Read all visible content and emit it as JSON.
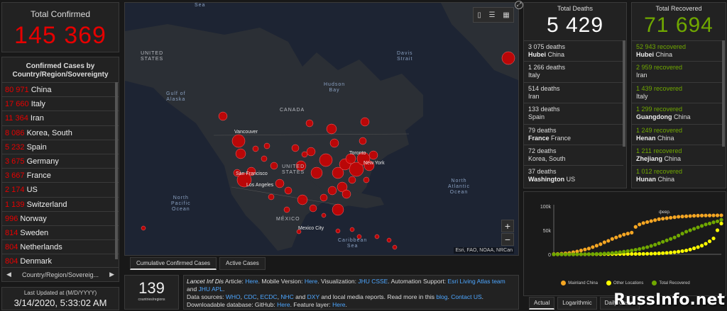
{
  "total_confirmed": {
    "label": "Total Confirmed",
    "value": "145 369"
  },
  "country_list": {
    "header": "Confirmed Cases by Country/Region/Sovereignty",
    "items": [
      {
        "n": "80 971",
        "c": "China"
      },
      {
        "n": "17 660",
        "c": "Italy"
      },
      {
        "n": "11 364",
        "c": "Iran"
      },
      {
        "n": "8 086",
        "c": "Korea, South"
      },
      {
        "n": "5 232",
        "c": "Spain"
      },
      {
        "n": "3 675",
        "c": "Germany"
      },
      {
        "n": "3 667",
        "c": "France"
      },
      {
        "n": "2 174",
        "c": "US"
      },
      {
        "n": "1 139",
        "c": "Switzerland"
      },
      {
        "n": "996",
        "c": "Norway"
      },
      {
        "n": "814",
        "c": "Sweden"
      },
      {
        "n": "804",
        "c": "Netherlands"
      },
      {
        "n": "804",
        "c": "Denmark"
      }
    ],
    "selector": "Country/Region/Sovereig..."
  },
  "last_updated": {
    "label": "Last Updated at (M/D/YYYY)",
    "value": "3/14/2020, 5:33:02 AM"
  },
  "map": {
    "labels": {
      "sea": "Sea",
      "united_states_top": "UNITED\nSTATES",
      "gulf_alaska": "Gulf of\nAlaska",
      "hudson": "Hudson\nBay",
      "davis": "Davis\nStrait",
      "canada": "CANADA",
      "united_states": "UNITED\nSTATES",
      "north_pacific": "North\nPacific\nOcean",
      "north_atlantic": "North\nAtlantic\nOcean",
      "mexico": "MÉXICO",
      "caribbean": "Caribbean\nSea",
      "vancouver": "Vancouver",
      "toronto": "Toronto",
      "new_york": "New York",
      "san_francisco": "San Francisco",
      "los_angeles": "Los Angeles",
      "mexico_city": "Mexico City"
    },
    "attribution": "Esri, FAO, NOAA, NRCan",
    "zoom_in": "+",
    "zoom_out": "−"
  },
  "map_tabs": [
    "Cumulative Confirmed Cases",
    "Active Cases"
  ],
  "country_count": {
    "value": "139",
    "label": "countries/regions"
  },
  "info": {
    "p1": "Lancet Inf Dis",
    "p1b": " Article: ",
    "here1": "Here",
    "p2": ". Mobile Version: ",
    "here2": "Here",
    "p3": ". Visualization: ",
    "jhu": "JHU CSSE",
    "p4": ". Automation Support: ",
    "esri": "Esri Living Atlas team",
    "p5": " and ",
    "jhuapl": "JHU APL",
    "p6": ".",
    "p7": "Data sources: ",
    "who": "WHO",
    "cdc": "CDC",
    "ecdc": "ECDC",
    "nhc": "NHC",
    "p8": " and ",
    "dxy": "DXY",
    "p9": " and local media reports. Read more in this ",
    "blog": "blog",
    "p10": ". ",
    "contact": "Contact US",
    "p11": ".",
    "p12": "Downloadable database: GitHub: ",
    "here3": "Here",
    "p13": ". Feature layer: ",
    "here4": "Here",
    "p14": "."
  },
  "deaths": {
    "label": "Total Deaths",
    "value": "5 429",
    "items": [
      {
        "v": "3 075 deaths",
        "p": "Hubei",
        "r": " China"
      },
      {
        "v": "1 266 deaths",
        "p": "",
        "r": "Italy"
      },
      {
        "v": "514 deaths",
        "p": "",
        "r": "Iran"
      },
      {
        "v": "133 deaths",
        "p": "",
        "r": "Spain"
      },
      {
        "v": "79 deaths",
        "p": "France",
        "r": " France"
      },
      {
        "v": "72 deaths",
        "p": "",
        "r": "Korea, South"
      },
      {
        "v": "37 deaths",
        "p": "Washington",
        "r": " US"
      }
    ]
  },
  "recovered": {
    "label": "Total Recovered",
    "value": "71 694",
    "items": [
      {
        "v": "52 943 recovered",
        "p": "Hubei",
        "r": " China"
      },
      {
        "v": "2 959 recovered",
        "p": "",
        "r": "Iran"
      },
      {
        "v": "1 439 recovered",
        "p": "",
        "r": "Italy"
      },
      {
        "v": "1 299 recovered",
        "p": "Guangdong",
        "r": " China"
      },
      {
        "v": "1 249 recovered",
        "p": "Henan",
        "r": " China"
      },
      {
        "v": "1 211 recovered",
        "p": "Zhejiang",
        "r": " China"
      },
      {
        "v": "1 012 recovered",
        "p": "Hunan",
        "r": " China"
      }
    ]
  },
  "chart_data": {
    "type": "line",
    "yticks": [
      "100k",
      "50k",
      "0"
    ],
    "xlabel_tick": "февр.",
    "ylim": [
      0,
      100000
    ],
    "series": [
      {
        "name": "Mainland China",
        "color": "#f5a623",
        "values": [
          500,
          800,
          1300,
          2000,
          2800,
          4500,
          6000,
          8000,
          10000,
          12000,
          15000,
          18000,
          21000,
          25000,
          28000,
          32000,
          35000,
          38000,
          41000,
          43000,
          45000,
          57000,
          62000,
          65000,
          67000,
          69000,
          71000,
          73000,
          74000,
          75000,
          76000,
          77000,
          78000,
          78500,
          79000,
          79500,
          80000,
          80300,
          80500,
          80600,
          80700,
          80800,
          80900,
          81000
        ]
      },
      {
        "name": "Other Locations",
        "color": "#ffff00",
        "values": [
          0,
          0,
          0,
          0,
          0,
          0,
          100,
          150,
          200,
          250,
          300,
          350,
          400,
          450,
          500,
          550,
          600,
          650,
          700,
          750,
          800,
          850,
          900,
          1000,
          1200,
          1400,
          1700,
          2000,
          2500,
          3000,
          3700,
          4500,
          5500,
          6700,
          8000,
          10000,
          12500,
          15000,
          18000,
          22000,
          27000,
          33000,
          50000,
          64000
        ]
      },
      {
        "name": "Total Recovered",
        "color": "#70a800",
        "values": [
          0,
          0,
          0,
          0,
          0,
          0,
          100,
          200,
          300,
          400,
          600,
          900,
          1200,
          1600,
          2100,
          2800,
          3500,
          4500,
          5500,
          6700,
          8000,
          9500,
          11000,
          13000,
          15000,
          17500,
          20000,
          23000,
          26000,
          29000,
          32000,
          35000,
          39000,
          43000,
          47000,
          50000,
          53000,
          56000,
          59000,
          62000,
          64000,
          66500,
          68500,
          71694
        ]
      }
    ]
  },
  "chart_tabs": [
    "Actual",
    "Logarithmic",
    "Daily Cases"
  ],
  "watermark": "RussInfo.net",
  "colors": {
    "confirmed": "#e60000",
    "recovered": "#70a800"
  }
}
